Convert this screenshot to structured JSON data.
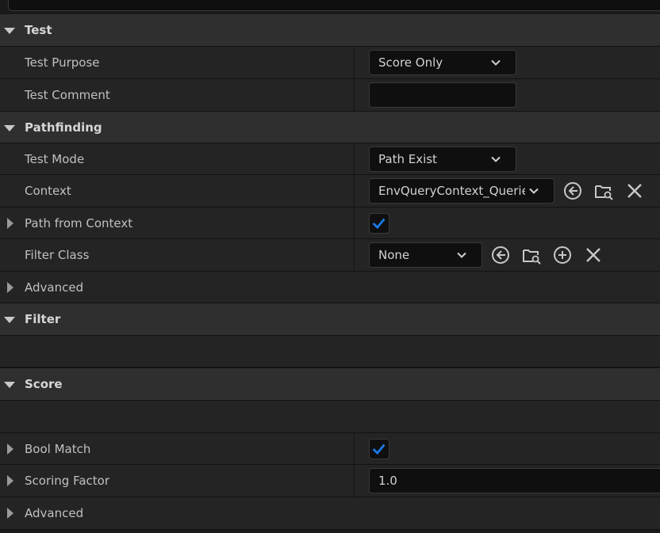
{
  "sections": {
    "test": {
      "label": "Test",
      "test_purpose": {
        "label": "Test Purpose",
        "value": "Score Only"
      },
      "test_comment": {
        "label": "Test Comment",
        "value": ""
      }
    },
    "pathfinding": {
      "label": "Pathfinding",
      "test_mode": {
        "label": "Test Mode",
        "value": "Path Exist"
      },
      "context": {
        "label": "Context",
        "value": "EnvQueryContext_Querier"
      },
      "path_from_context": {
        "label": "Path from Context",
        "checked": true
      },
      "filter_class": {
        "label": "Filter Class",
        "value": "None"
      },
      "advanced": {
        "label": "Advanced"
      }
    },
    "filter": {
      "label": "Filter"
    },
    "score": {
      "label": "Score",
      "bool_match": {
        "label": "Bool Match",
        "checked": true
      },
      "scoring_factor": {
        "label": "Scoring Factor",
        "value": "1.0"
      },
      "advanced": {
        "label": "Advanced"
      }
    }
  },
  "icons": {
    "browse": "arrow-left-circle-icon",
    "find": "folder-search-icon",
    "add": "plus-circle-icon",
    "clear": "close-icon",
    "dropdown": "chevron-down-icon",
    "check": "checkmark-icon"
  },
  "colors": {
    "accent_check": "#1a7ae8",
    "category_bg": "#2f2f2f",
    "property_bg": "#242424",
    "input_bg": "#0f0f0f"
  }
}
